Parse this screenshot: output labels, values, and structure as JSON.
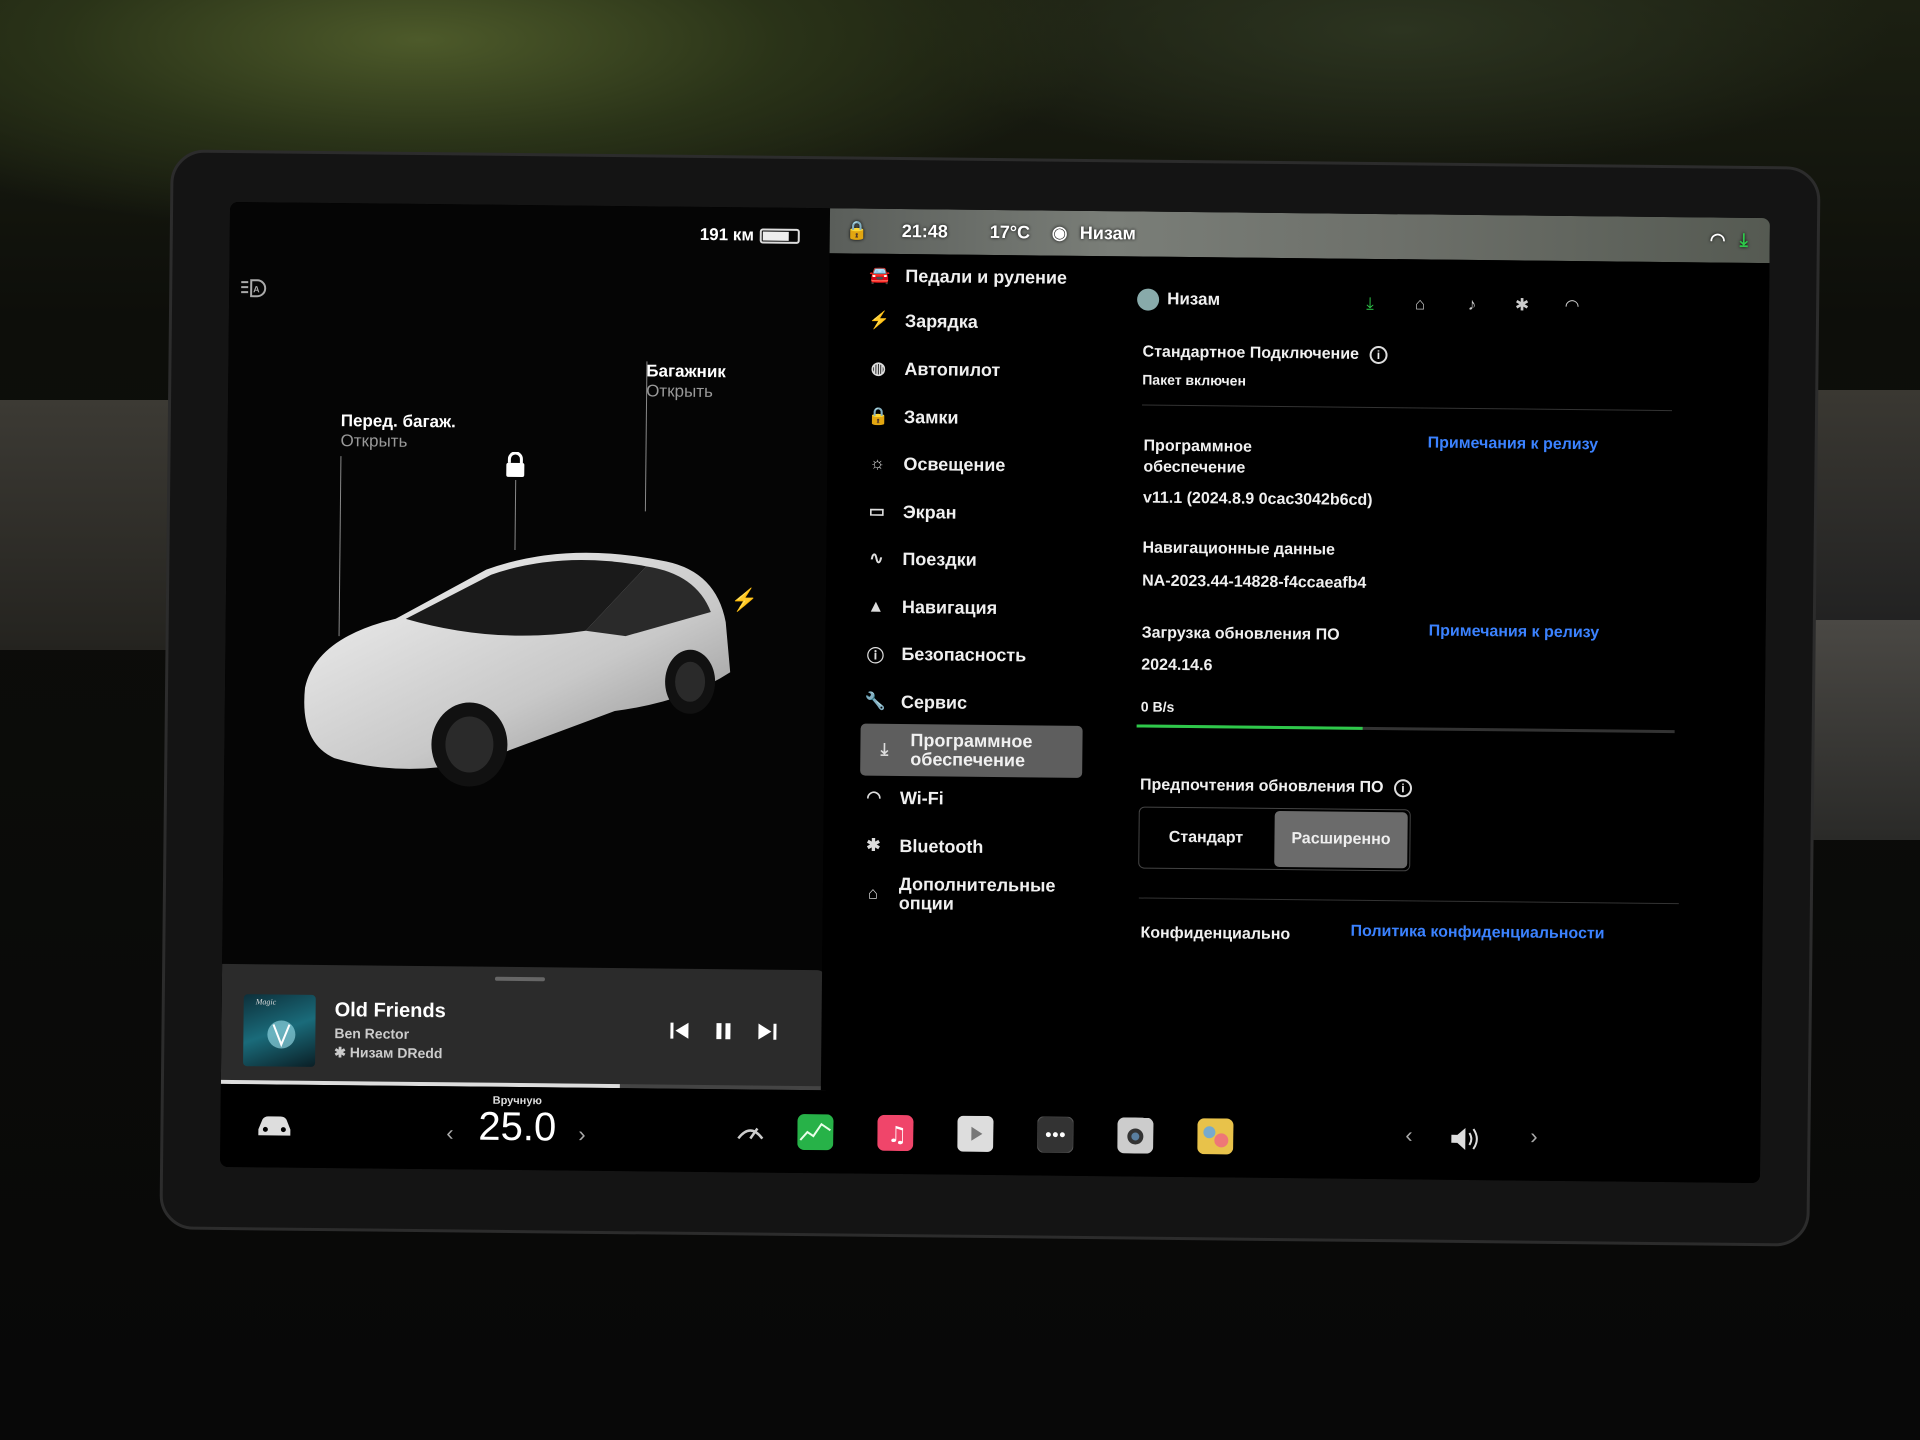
{
  "status": {
    "range": "191 км",
    "battery_level": 0.75,
    "time": "21:48",
    "temperature": "17°C",
    "profile_name": "Низам"
  },
  "car": {
    "frunk_title": "Перед. багаж.",
    "frunk_action": "Открыть",
    "trunk_title": "Багажник",
    "trunk_action": "Открыть"
  },
  "media": {
    "title": "Old Friends",
    "artist": "Ben Rector",
    "source": "Низам DRedd",
    "album_art_text": "Magic",
    "progress": 0.66
  },
  "menu": {
    "items": [
      {
        "label": "Педали и руление",
        "icon": "car-icon"
      },
      {
        "label": "Зарядка",
        "icon": "bolt-icon"
      },
      {
        "label": "Автопилот",
        "icon": "steering-wheel-icon"
      },
      {
        "label": "Замки",
        "icon": "lock-icon"
      },
      {
        "label": "Освещение",
        "icon": "sun-icon"
      },
      {
        "label": "Экран",
        "icon": "display-icon"
      },
      {
        "label": "Поездки",
        "icon": "trips-icon"
      },
      {
        "label": "Навигация",
        "icon": "navigation-icon"
      },
      {
        "label": "Безопасность",
        "icon": "alert-icon"
      },
      {
        "label": "Сервис",
        "icon": "wrench-icon"
      },
      {
        "label": "Программное обеспечение",
        "icon": "download-icon"
      },
      {
        "label": "Wi-Fi",
        "icon": "wifi-icon"
      },
      {
        "label": "Bluetooth",
        "icon": "bluetooth-icon"
      },
      {
        "label": "Дополнительные опции",
        "icon": "bag-icon"
      }
    ]
  },
  "content": {
    "profile_name": "Низам",
    "connectivity_title": "Стандартное Подключение",
    "connectivity_status": "Пакет включен",
    "software_label": "Программное обеспечение",
    "release_notes_link": "Примечания к релизу",
    "software_version": "v11.1 (2024.8.9 0cac3042b6cd)",
    "nav_data_label": "Навигационные данные",
    "nav_data_version": "NA-2023.44-14828-f4ccaeafb4",
    "update_label": "Загрузка обновления ПО",
    "update_release_notes_link": "Примечания к релизу",
    "update_version": "2024.14.6",
    "download_speed": "0 B/s",
    "download_progress": 0.42,
    "preferences_label": "Предпочтения обновления ПО",
    "pref_standard": "Стандарт",
    "pref_advanced": "Расширенно",
    "pref_selected": "Расширенно",
    "privacy_label": "Конфиденциально",
    "privacy_link": "Политика конфиденциальности"
  },
  "taskbar": {
    "temp_mode": "Вручную",
    "temp_value": "25.0",
    "colors": {
      "stocks": "#27b248",
      "music": "#f0456a",
      "accent_green": "#2ec84a",
      "link_blue": "#3b82ff"
    }
  }
}
